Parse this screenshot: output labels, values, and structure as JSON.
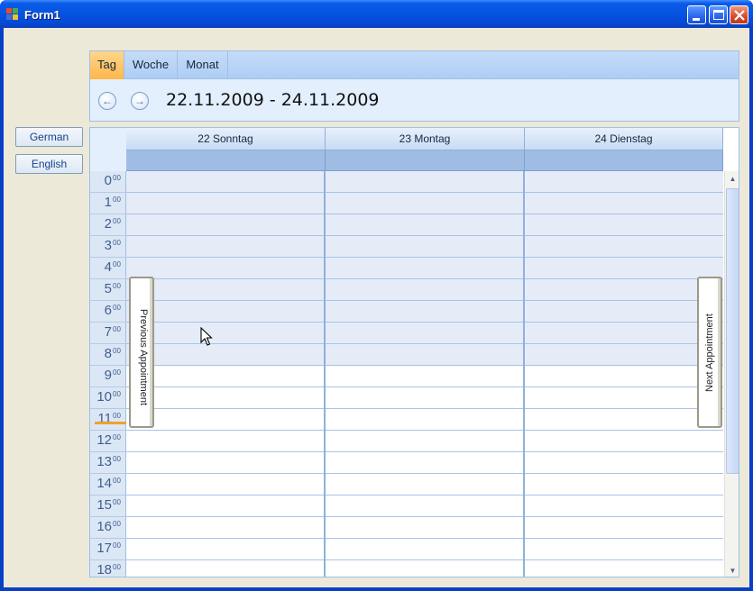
{
  "window": {
    "title": "Form1"
  },
  "language_buttons": [
    "German",
    "English"
  ],
  "view_tabs": [
    {
      "label": "Tag",
      "active": true
    },
    {
      "label": "Woche",
      "active": false
    },
    {
      "label": "Monat",
      "active": false
    }
  ],
  "navigation": {
    "date_range": "22.11.2009 - 24.11.2009",
    "prev_icon": "arrow-left-icon",
    "next_icon": "arrow-right-icon"
  },
  "days": [
    "22 Sonntag",
    "23 Montag",
    "24 Dienstag"
  ],
  "hours": [
    "0",
    "1",
    "2",
    "3",
    "4",
    "5",
    "6",
    "7",
    "8",
    "9",
    "10",
    "11",
    "12",
    "13",
    "14",
    "15",
    "16",
    "17",
    "18"
  ],
  "minute_superscript": "00",
  "working_hours_start": 9,
  "current_time_hour": 11,
  "appointment_nav": {
    "previous": "Previous Appointment",
    "next": "Next Appointment"
  },
  "colors": {
    "active_tab": "#ffb749",
    "header": "#c6dcf8",
    "all_day": "#9ebce4",
    "off_hours": "#e5ecf7"
  }
}
